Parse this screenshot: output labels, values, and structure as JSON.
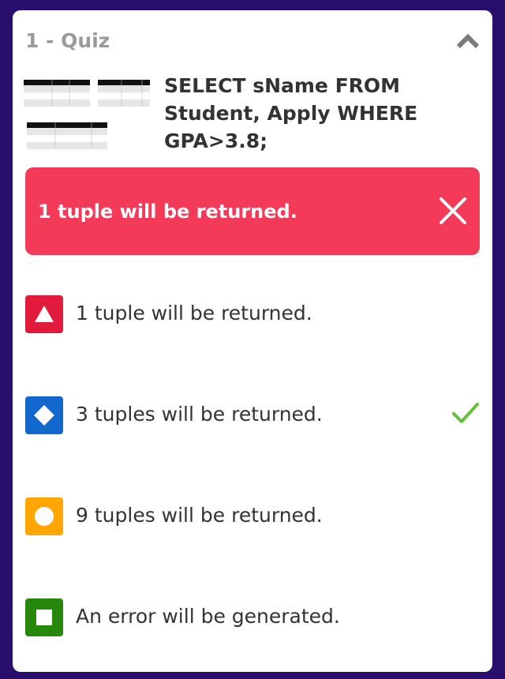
{
  "quiz": {
    "title": "1 - Quiz",
    "question": "SELECT sName FROM Student, Apply WHERE GPA>3.8;"
  },
  "answer_banner": {
    "text": "1 tuple will be returned.",
    "color": "#f43a59"
  },
  "options": [
    {
      "label": "1 tuple will be returned.",
      "icon": "triangle-icon",
      "color": "#e21b3c",
      "correct": false
    },
    {
      "label": "3 tuples will be returned.",
      "icon": "diamond-icon",
      "color": "#1368ce",
      "correct": true
    },
    {
      "label": "9 tuples will be returned.",
      "icon": "circle-icon",
      "color": "#ffa602",
      "correct": false
    },
    {
      "label": "An error will be generated.",
      "icon": "square-icon",
      "color": "#26890c",
      "correct": false
    }
  ],
  "colors": {
    "background": "#2a0e6e",
    "check": "#66bf39"
  }
}
